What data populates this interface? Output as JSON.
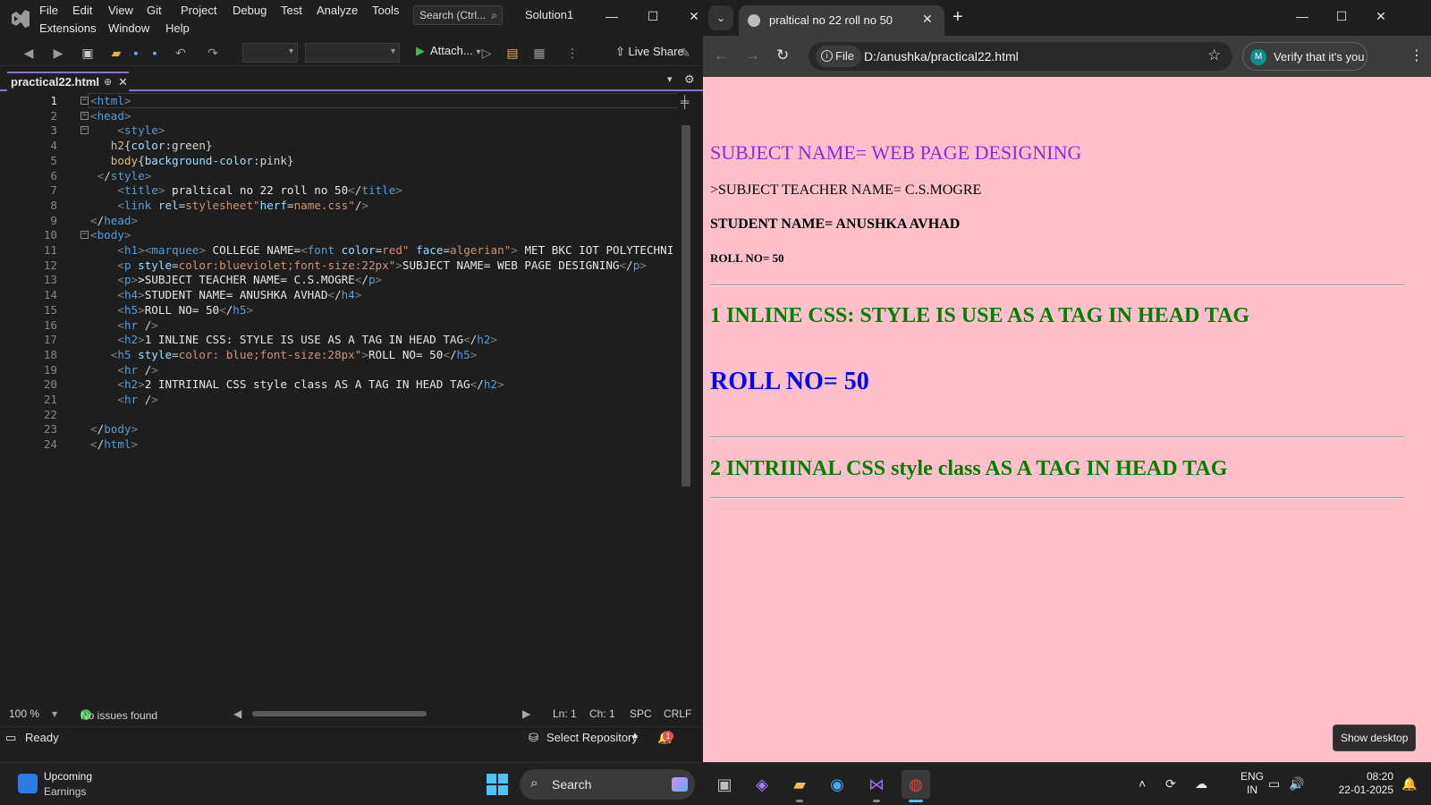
{
  "vs": {
    "menu": [
      "File",
      "Edit",
      "View",
      "Git",
      "Project",
      "Debug",
      "Test",
      "Analyze",
      "Tools",
      "Extensions",
      "Window",
      "Help"
    ],
    "search_placeholder": "Search (Ctrl...",
    "solution": "Solution1",
    "toolbar": {
      "attach_label": "Attach...",
      "live_share_label": "Live Share"
    },
    "tab": {
      "filename": "practical22.html"
    },
    "code_lines": [
      "<html>",
      "<head>",
      "    <style>",
      "   h2{color:green}",
      "   body{background-color:pink}",
      " </style>",
      "    <title> praltical no 22 roll no 50</title>",
      "    <link rel=\"stylesheet\"herf=\"name.css\"/>",
      "</head>",
      "<body>",
      "    <h1><marquee> COLLEGE NAME=<font color=\"red\" face=\"algerian\"> MET BKC IOT POLYTECHNI",
      "    <p style=\"color:blueviolet;font-size:22px\">SUBJECT NAME= WEB PAGE DESIGNING</p>",
      "    <p>>SUBJECT TEACHER NAME= C.S.MOGRE</p>",
      "    <h4>STUDENT NAME= ANUSHKA AVHAD</h4>",
      "    <h5>ROLL NO= 50</h5>",
      "    <hr />",
      "    <h2>1 INLINE CSS: STYLE IS USE AS A TAG IN HEAD TAG</h2>",
      "   <h5 style=\"color: blue;font-size:28px\">ROLL NO= 50</h5>",
      "    <hr />",
      "    <h2>2 INTRIINAL CSS style class AS A TAG IN HEAD TAG</h2>",
      "    <hr />",
      "",
      "</body>",
      "</html>"
    ],
    "status_row": {
      "zoom": "100 %",
      "issues": "No issues found",
      "ln": "Ln: 1",
      "ch": "Ch: 1",
      "spc": "SPC",
      "crlf": "CRLF"
    },
    "statusbar": {
      "ready": "Ready",
      "repo": "Select Repository",
      "notifications": "1"
    }
  },
  "chrome": {
    "tab_title": "praltical no 22 roll no 50",
    "chip_label": "File",
    "url": "D:/anushka/practical22.html",
    "verify_label": "Verify that it's you",
    "avatar_letter": "M",
    "page": {
      "subject": "SUBJECT NAME= WEB PAGE DESIGNING",
      "teacher": ">SUBJECT TEACHER NAME= C.S.MOGRE",
      "student": "STUDENT NAME= ANUSHKA AVHAD",
      "roll_small": "ROLL NO= 50",
      "inline_heading": "1 INLINE CSS: STYLE IS USE AS A TAG IN HEAD TAG",
      "roll_big": "ROLL NO= 50",
      "internal_heading": "2 INTRIINAL CSS style class AS A TAG IN HEAD TAG"
    },
    "tooltip": "Show desktop"
  },
  "taskbar": {
    "weather_title": "Upcoming",
    "weather_sub": "Earnings",
    "search_label": "Search",
    "lang_top": "ENG",
    "lang_bottom": "IN",
    "time": "08:20",
    "date": "22-01-2025"
  },
  "colors": {
    "page_bg": "pink",
    "subject": "blueviolet",
    "h2": "green",
    "roll_big": "blue",
    "vs_accent": "#8c6bd6"
  }
}
